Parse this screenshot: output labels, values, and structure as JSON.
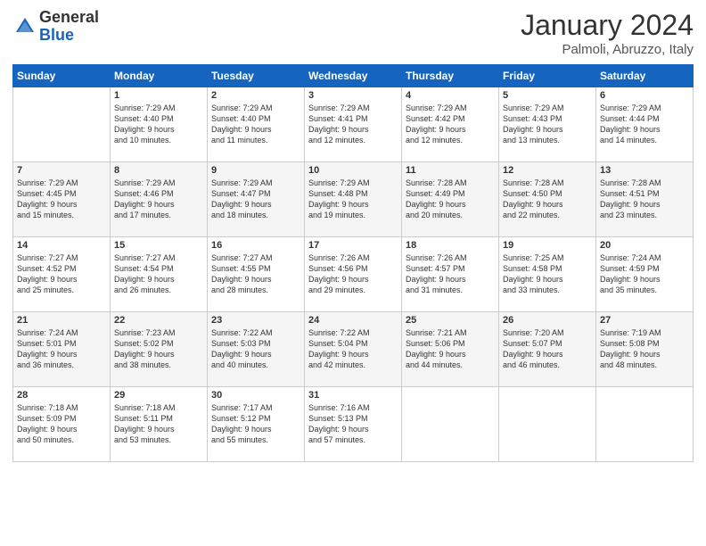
{
  "logo": {
    "general": "General",
    "blue": "Blue"
  },
  "title": "January 2024",
  "subtitle": "Palmoli, Abruzzo, Italy",
  "days_of_week": [
    "Sunday",
    "Monday",
    "Tuesday",
    "Wednesday",
    "Thursday",
    "Friday",
    "Saturday"
  ],
  "weeks": [
    [
      {
        "day": "",
        "content": ""
      },
      {
        "day": "1",
        "content": "Sunrise: 7:29 AM\nSunset: 4:40 PM\nDaylight: 9 hours\nand 10 minutes."
      },
      {
        "day": "2",
        "content": "Sunrise: 7:29 AM\nSunset: 4:40 PM\nDaylight: 9 hours\nand 11 minutes."
      },
      {
        "day": "3",
        "content": "Sunrise: 7:29 AM\nSunset: 4:41 PM\nDaylight: 9 hours\nand 12 minutes."
      },
      {
        "day": "4",
        "content": "Sunrise: 7:29 AM\nSunset: 4:42 PM\nDaylight: 9 hours\nand 12 minutes."
      },
      {
        "day": "5",
        "content": "Sunrise: 7:29 AM\nSunset: 4:43 PM\nDaylight: 9 hours\nand 13 minutes."
      },
      {
        "day": "6",
        "content": "Sunrise: 7:29 AM\nSunset: 4:44 PM\nDaylight: 9 hours\nand 14 minutes."
      }
    ],
    [
      {
        "day": "7",
        "content": "Sunrise: 7:29 AM\nSunset: 4:45 PM\nDaylight: 9 hours\nand 15 minutes."
      },
      {
        "day": "8",
        "content": "Sunrise: 7:29 AM\nSunset: 4:46 PM\nDaylight: 9 hours\nand 17 minutes."
      },
      {
        "day": "9",
        "content": "Sunrise: 7:29 AM\nSunset: 4:47 PM\nDaylight: 9 hours\nand 18 minutes."
      },
      {
        "day": "10",
        "content": "Sunrise: 7:29 AM\nSunset: 4:48 PM\nDaylight: 9 hours\nand 19 minutes."
      },
      {
        "day": "11",
        "content": "Sunrise: 7:28 AM\nSunset: 4:49 PM\nDaylight: 9 hours\nand 20 minutes."
      },
      {
        "day": "12",
        "content": "Sunrise: 7:28 AM\nSunset: 4:50 PM\nDaylight: 9 hours\nand 22 minutes."
      },
      {
        "day": "13",
        "content": "Sunrise: 7:28 AM\nSunset: 4:51 PM\nDaylight: 9 hours\nand 23 minutes."
      }
    ],
    [
      {
        "day": "14",
        "content": "Sunrise: 7:27 AM\nSunset: 4:52 PM\nDaylight: 9 hours\nand 25 minutes."
      },
      {
        "day": "15",
        "content": "Sunrise: 7:27 AM\nSunset: 4:54 PM\nDaylight: 9 hours\nand 26 minutes."
      },
      {
        "day": "16",
        "content": "Sunrise: 7:27 AM\nSunset: 4:55 PM\nDaylight: 9 hours\nand 28 minutes."
      },
      {
        "day": "17",
        "content": "Sunrise: 7:26 AM\nSunset: 4:56 PM\nDaylight: 9 hours\nand 29 minutes."
      },
      {
        "day": "18",
        "content": "Sunrise: 7:26 AM\nSunset: 4:57 PM\nDaylight: 9 hours\nand 31 minutes."
      },
      {
        "day": "19",
        "content": "Sunrise: 7:25 AM\nSunset: 4:58 PM\nDaylight: 9 hours\nand 33 minutes."
      },
      {
        "day": "20",
        "content": "Sunrise: 7:24 AM\nSunset: 4:59 PM\nDaylight: 9 hours\nand 35 minutes."
      }
    ],
    [
      {
        "day": "21",
        "content": "Sunrise: 7:24 AM\nSunset: 5:01 PM\nDaylight: 9 hours\nand 36 minutes."
      },
      {
        "day": "22",
        "content": "Sunrise: 7:23 AM\nSunset: 5:02 PM\nDaylight: 9 hours\nand 38 minutes."
      },
      {
        "day": "23",
        "content": "Sunrise: 7:22 AM\nSunset: 5:03 PM\nDaylight: 9 hours\nand 40 minutes."
      },
      {
        "day": "24",
        "content": "Sunrise: 7:22 AM\nSunset: 5:04 PM\nDaylight: 9 hours\nand 42 minutes."
      },
      {
        "day": "25",
        "content": "Sunrise: 7:21 AM\nSunset: 5:06 PM\nDaylight: 9 hours\nand 44 minutes."
      },
      {
        "day": "26",
        "content": "Sunrise: 7:20 AM\nSunset: 5:07 PM\nDaylight: 9 hours\nand 46 minutes."
      },
      {
        "day": "27",
        "content": "Sunrise: 7:19 AM\nSunset: 5:08 PM\nDaylight: 9 hours\nand 48 minutes."
      }
    ],
    [
      {
        "day": "28",
        "content": "Sunrise: 7:18 AM\nSunset: 5:09 PM\nDaylight: 9 hours\nand 50 minutes."
      },
      {
        "day": "29",
        "content": "Sunrise: 7:18 AM\nSunset: 5:11 PM\nDaylight: 9 hours\nand 53 minutes."
      },
      {
        "day": "30",
        "content": "Sunrise: 7:17 AM\nSunset: 5:12 PM\nDaylight: 9 hours\nand 55 minutes."
      },
      {
        "day": "31",
        "content": "Sunrise: 7:16 AM\nSunset: 5:13 PM\nDaylight: 9 hours\nand 57 minutes."
      },
      {
        "day": "",
        "content": ""
      },
      {
        "day": "",
        "content": ""
      },
      {
        "day": "",
        "content": ""
      }
    ]
  ]
}
